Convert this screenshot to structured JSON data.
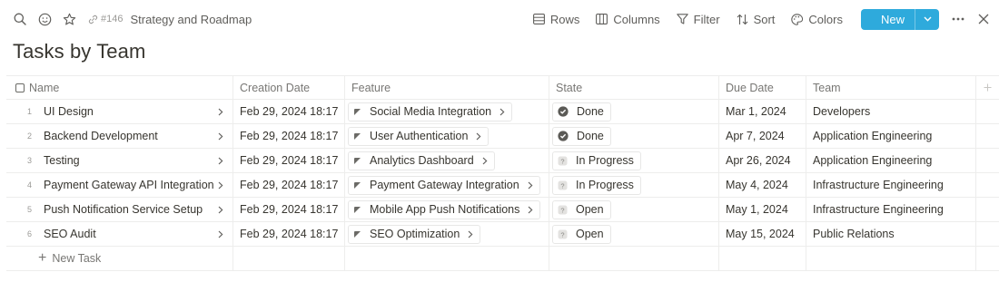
{
  "toolbar": {
    "page_id": "#146",
    "page_title": "Strategy and Roadmap",
    "rows_label": "Rows",
    "columns_label": "Columns",
    "filter_label": "Filter",
    "sort_label": "Sort",
    "colors_label": "Colors",
    "new_label": "New",
    "accent_color": "#2eaadc"
  },
  "heading": "Tasks by Team",
  "table": {
    "columns": [
      "Name",
      "Creation Date",
      "Feature",
      "State",
      "Due Date",
      "Team"
    ],
    "rows": [
      {
        "num": "1",
        "name": "UI Design",
        "created": "Feb 29, 2024 18:17",
        "feature": "Social Media Integration",
        "state": "Done",
        "state_icon": "check-circle-icon",
        "due": "Mar 1, 2024",
        "team": "Developers"
      },
      {
        "num": "2",
        "name": "Backend Development",
        "created": "Feb 29, 2024 18:17",
        "feature": "User Authentication",
        "state": "Done",
        "state_icon": "check-circle-icon",
        "due": "Apr 7, 2024",
        "team": "Application Engineering"
      },
      {
        "num": "3",
        "name": "Testing",
        "created": "Feb 29, 2024 18:17",
        "feature": "Analytics Dashboard",
        "state": "In Progress",
        "state_icon": "question-icon",
        "due": "Apr 26, 2024",
        "team": "Application Engineering"
      },
      {
        "num": "4",
        "name": "Payment Gateway API Integration",
        "created": "Feb 29, 2024 18:17",
        "feature": "Payment Gateway Integration",
        "state": "In Progress",
        "state_icon": "question-icon",
        "due": "May 4, 2024",
        "team": "Infrastructure Engineering"
      },
      {
        "num": "5",
        "name": "Push Notification Service Setup",
        "created": "Feb 29, 2024 18:17",
        "feature": "Mobile App Push Notifications",
        "state": "Open",
        "state_icon": "question-icon",
        "due": "May 1, 2024",
        "team": "Infrastructure Engineering"
      },
      {
        "num": "6",
        "name": "SEO Audit",
        "created": "Feb 29, 2024 18:17",
        "feature": "SEO Optimization",
        "state": "Open",
        "state_icon": "question-icon",
        "due": "May 15, 2024",
        "team": "Public Relations"
      }
    ],
    "new_task_label": "New Task"
  }
}
